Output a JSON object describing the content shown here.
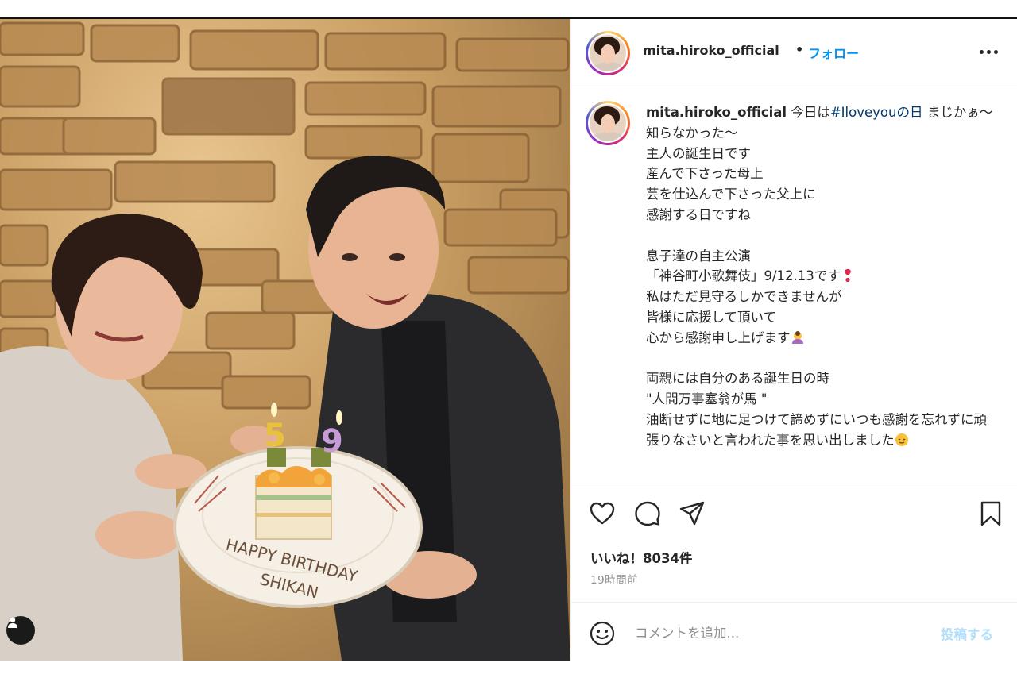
{
  "post": {
    "username": "mita.hiroko_official",
    "separator": "•",
    "follow_label": "フォロー",
    "more_icon": "more-horizontal-icon"
  },
  "caption": {
    "username": "mita.hiroko_official",
    "intro": " 今日は",
    "hashtag": "#Iloveyouの日",
    "body1": " まじかぁ〜\n知らなかった〜\n主人の誕生日です\n産んで下さった母上\n芸を仕込んで下さった父上に\n感謝する日ですね\n\n息子達の自主公演\n「神谷町小歌舞伎」9/12.13です",
    "emoji1": "heart-exclamation-emoji",
    "body2": "\n私はただ見守るしかできませんが\n皆様に応援して頂いて\n心から感謝申し上げます",
    "emoji2": "person-bowing-emoji",
    "body3": "\n\n両親には自分のある誕生日の時\n\"人間万事塞翁が馬 \"\n油断せずに地に足つけて諦めずにいつも感謝を忘れずに頑張りなさいと言われた事を思い出しました",
    "emoji3": "relieved-face-emoji"
  },
  "photo": {
    "plate_text_line1": "HAPPY BIRTHDAY",
    "plate_text_line2": "SHIKAN",
    "candle_digit_1": "5",
    "candle_digit_2": "9",
    "user_tag_icon": "user-tag-icon"
  },
  "actions": {
    "like_icon": "heart-icon",
    "comment_icon": "comment-icon",
    "share_icon": "paper-plane-icon",
    "save_icon": "bookmark-icon",
    "likes_text": "いいね！8034件",
    "timestamp": "19時間前"
  },
  "comment_bar": {
    "emoji_icon": "smiley-icon",
    "placeholder": "コメントを追加...",
    "post_label": "投稿する"
  },
  "colors": {
    "link_blue": "#0095f6",
    "hashtag_blue": "#00376b",
    "post_disabled": "#b2dffc",
    "muted_gray": "#8e8e8e"
  }
}
